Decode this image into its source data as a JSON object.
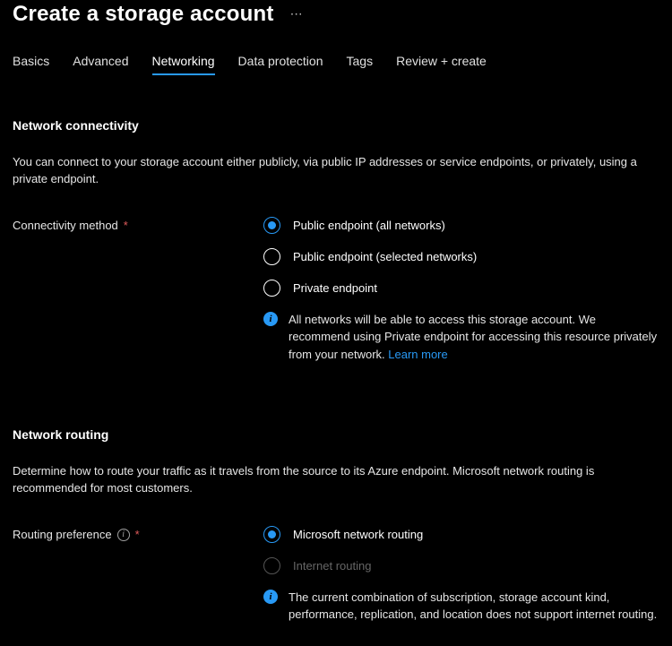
{
  "title": "Create a storage account",
  "more": "⋯",
  "tabs": {
    "basics": "Basics",
    "advanced": "Advanced",
    "networking": "Networking",
    "data_protection": "Data protection",
    "tags": "Tags",
    "review_create": "Review + create"
  },
  "network_connectivity": {
    "heading": "Network connectivity",
    "description": "You can connect to your storage account either publicly, via public IP addresses or service endpoints, or privately, using a private endpoint.",
    "field_label": "Connectivity method",
    "required_mark": "*",
    "options": {
      "public_all": "Public endpoint (all networks)",
      "public_selected": "Public endpoint (selected networks)",
      "private": "Private endpoint"
    },
    "info_text": "All networks will be able to access this storage account. We recommend using Private endpoint for accessing this resource privately from your network. ",
    "info_link": "Learn more"
  },
  "network_routing": {
    "heading": "Network routing",
    "description": "Determine how to route your traffic as it travels from the source to its Azure endpoint. Microsoft network routing is recommended for most customers.",
    "field_label": "Routing preference",
    "required_mark": "*",
    "options": {
      "microsoft": "Microsoft network routing",
      "internet": "Internet routing"
    },
    "info_text": "The current combination of subscription, storage account kind, performance, replication, and location does not support internet routing."
  }
}
